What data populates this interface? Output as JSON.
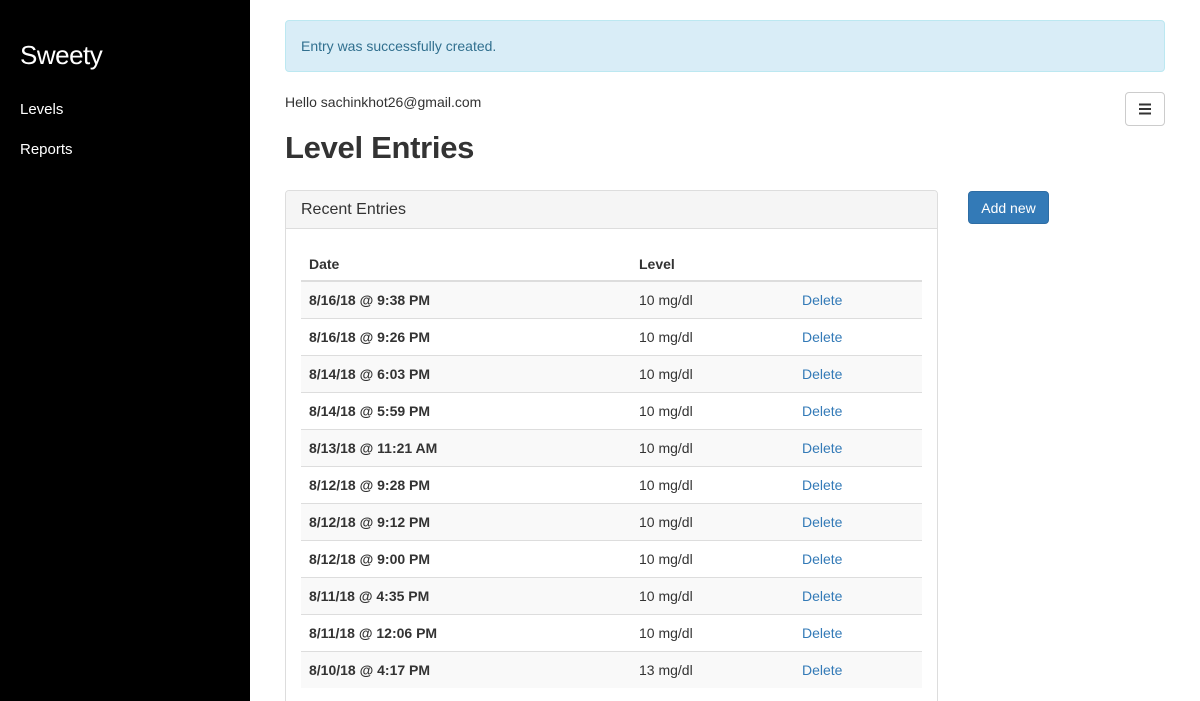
{
  "sidebar": {
    "brand": "Sweety",
    "items": [
      {
        "label": "Levels"
      },
      {
        "label": "Reports"
      }
    ]
  },
  "alert": {
    "message": "Entry was successfully created."
  },
  "header": {
    "greeting": "Hello sachinkhot26@gmail.com",
    "menu_icon": "hamburger-icon"
  },
  "page": {
    "title": "Level Entries"
  },
  "panel": {
    "title": "Recent Entries",
    "columns": [
      "Date",
      "Level",
      ""
    ],
    "rows": [
      {
        "date": "8/16/18 @ 9:38 PM",
        "level": "10 mg/dl",
        "action": "Delete"
      },
      {
        "date": "8/16/18 @ 9:26 PM",
        "level": "10 mg/dl",
        "action": "Delete"
      },
      {
        "date": "8/14/18 @ 6:03 PM",
        "level": "10 mg/dl",
        "action": "Delete"
      },
      {
        "date": "8/14/18 @ 5:59 PM",
        "level": "10 mg/dl",
        "action": "Delete"
      },
      {
        "date": "8/13/18 @ 11:21 AM",
        "level": "10 mg/dl",
        "action": "Delete"
      },
      {
        "date": "8/12/18 @ 9:28 PM",
        "level": "10 mg/dl",
        "action": "Delete"
      },
      {
        "date": "8/12/18 @ 9:12 PM",
        "level": "10 mg/dl",
        "action": "Delete"
      },
      {
        "date": "8/12/18 @ 9:00 PM",
        "level": "10 mg/dl",
        "action": "Delete"
      },
      {
        "date": "8/11/18 @ 4:35 PM",
        "level": "10 mg/dl",
        "action": "Delete"
      },
      {
        "date": "8/11/18 @ 12:06 PM",
        "level": "10 mg/dl",
        "action": "Delete"
      },
      {
        "date": "8/10/18 @ 4:17 PM",
        "level": "13 mg/dl",
        "action": "Delete"
      }
    ]
  },
  "actions": {
    "add_new_label": "Add new"
  },
  "colors": {
    "sidebar_bg": "#000000",
    "alert_bg": "#d9edf7",
    "alert_text": "#31708f",
    "primary": "#337ab7",
    "link": "#337ab7"
  }
}
